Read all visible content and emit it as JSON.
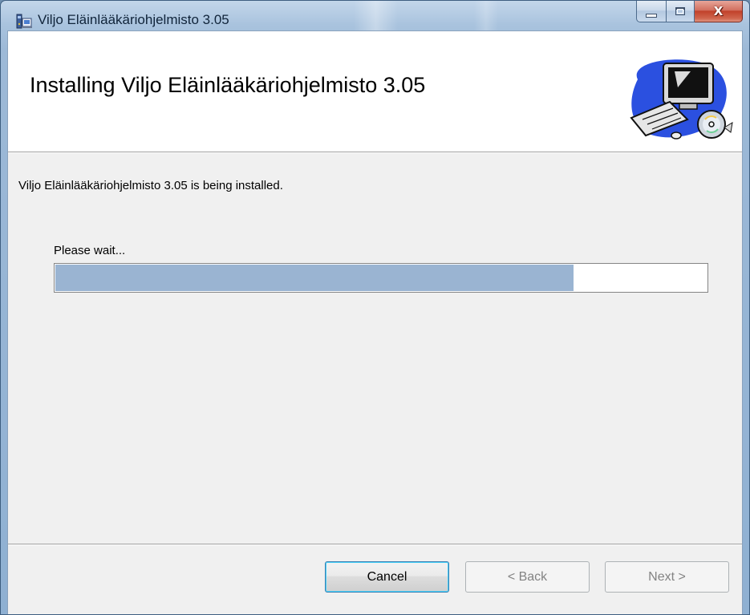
{
  "window": {
    "title": "Viljo Eläinlääkäriohjelmisto 3.05",
    "icons": {
      "app": "installer-app-icon",
      "minimize": "minimize-icon",
      "maximize": "maximize-icon",
      "close": "close-icon"
    },
    "close_glyph": "X"
  },
  "banner": {
    "title": "Installing Viljo Eläinlääkäriohjelmisto 3.05",
    "art_icon": "computer-with-cd-icon"
  },
  "body": {
    "status": "Viljo Eläinlääkäriohjelmisto 3.05 is being installed.",
    "wait_label": "Please wait...",
    "progress_fraction": 0.795
  },
  "buttons": {
    "cancel": "Cancel",
    "back": "< Back",
    "next": "Next >"
  },
  "colors": {
    "progress_fill": "#9ab4d2",
    "close_button": "#c1412a",
    "dialog_background": "#f0f0f0"
  }
}
